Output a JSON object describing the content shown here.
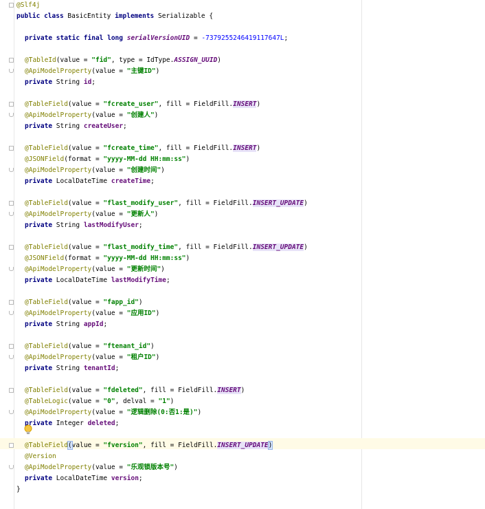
{
  "editor": {
    "class_annotation": "@Slf4j",
    "kw_public": "public",
    "kw_class": "class",
    "class_name": "BasicEntity",
    "kw_implements": "implements",
    "interface_name": "Serializable",
    "open_brace": "{",
    "close_brace": "}",
    "serial": {
      "modifiers": "private static final long",
      "name": "serialVersionUID",
      "assign": " = ",
      "value": "-7379255246419117647L",
      "semi": ";"
    },
    "fields": [
      {
        "annotations": [
          {
            "name": "@TableId",
            "args_prefix": "(value = ",
            "str": "\"fid\"",
            "args_mid": ", type = IdType.",
            "const": "ASSIGN_UUID",
            "args_suffix": ")"
          },
          {
            "name": "@ApiModelProperty",
            "args_prefix": "(value = ",
            "str": "\"主键ID\"",
            "args_suffix": ")"
          }
        ],
        "decl": {
          "modifier": "private",
          "type": "String",
          "name": "id",
          "semi": ";"
        }
      },
      {
        "annotations": [
          {
            "name": "@TableField",
            "args_prefix": "(value = ",
            "str": "\"fcreate_user\"",
            "args_mid": ", fill = FieldFill.",
            "const": "INSERT",
            "args_suffix": ")"
          },
          {
            "name": "@ApiModelProperty",
            "args_prefix": "(value = ",
            "str": "\"创建人\"",
            "args_suffix": ")"
          }
        ],
        "decl": {
          "modifier": "private",
          "type": "String",
          "name": "createUser",
          "semi": ";"
        }
      },
      {
        "annotations": [
          {
            "name": "@TableField",
            "args_prefix": "(value = ",
            "str": "\"fcreate_time\"",
            "args_mid": ", fill = FieldFill.",
            "const": "INSERT",
            "args_suffix": ")"
          },
          {
            "name": "@JSONField",
            "args_prefix": "(format = ",
            "str": "\"yyyy-MM-dd HH:mm:ss\"",
            "args_suffix": ")"
          },
          {
            "name": "@ApiModelProperty",
            "args_prefix": "(value = ",
            "str": "\"创建时间\"",
            "args_suffix": ")"
          }
        ],
        "decl": {
          "modifier": "private",
          "type": "LocalDateTime",
          "name": "createTime",
          "semi": ";"
        }
      },
      {
        "annotations": [
          {
            "name": "@TableField",
            "args_prefix": "(value = ",
            "str": "\"flast_modify_user\"",
            "args_mid": ", fill = FieldFill.",
            "const": "INSERT_UPDATE",
            "args_suffix": ")"
          },
          {
            "name": "@ApiModelProperty",
            "args_prefix": "(value = ",
            "str": "\"更新人\"",
            "args_suffix": ")"
          }
        ],
        "decl": {
          "modifier": "private",
          "type": "String",
          "name": "lastModifyUser",
          "semi": ";"
        }
      },
      {
        "annotations": [
          {
            "name": "@TableField",
            "args_prefix": "(value = ",
            "str": "\"flast_modify_time\"",
            "args_mid": ", fill = FieldFill.",
            "const": "INSERT_UPDATE",
            "args_suffix": ")"
          },
          {
            "name": "@JSONField",
            "args_prefix": "(format = ",
            "str": "\"yyyy-MM-dd HH:mm:ss\"",
            "args_suffix": ")"
          },
          {
            "name": "@ApiModelProperty",
            "args_prefix": "(value = ",
            "str": "\"更新时间\"",
            "args_suffix": ")"
          }
        ],
        "decl": {
          "modifier": "private",
          "type": "LocalDateTime",
          "name": "lastModifyTime",
          "semi": ";"
        }
      },
      {
        "annotations": [
          {
            "name": "@TableField",
            "args_prefix": "(value = ",
            "str": "\"fapp_id\"",
            "args_suffix": ")"
          },
          {
            "name": "@ApiModelProperty",
            "args_prefix": "(value = ",
            "str": "\"应用ID\"",
            "args_suffix": ")"
          }
        ],
        "decl": {
          "modifier": "private",
          "type": "String",
          "name": "appId",
          "semi": ";"
        }
      },
      {
        "annotations": [
          {
            "name": "@TableField",
            "args_prefix": "(value = ",
            "str": "\"ftenant_id\"",
            "args_suffix": ")"
          },
          {
            "name": "@ApiModelProperty",
            "args_prefix": "(value = ",
            "str": "\"租户ID\"",
            "args_suffix": ")"
          }
        ],
        "decl": {
          "modifier": "private",
          "type": "String",
          "name": "tenantId",
          "semi": ";"
        }
      },
      {
        "annotations": [
          {
            "name": "@TableField",
            "args_prefix": "(value = ",
            "str": "\"fdeleted\"",
            "args_mid": ", fill = FieldFill.",
            "const": "INSERT",
            "args_suffix": ")"
          },
          {
            "name": "@TableLogic",
            "args_prefix": "(value = ",
            "str": "\"0\"",
            "args_mid_plain": ", delval = ",
            "str2": "\"1\"",
            "args_suffix": ")"
          },
          {
            "name": "@ApiModelProperty",
            "args_prefix": "(value = ",
            "str": "\"逻辑删除(0:否1:是)\"",
            "args_suffix": ")"
          }
        ],
        "decl": {
          "modifier": "private",
          "type": "Integer",
          "name": "deleted",
          "semi": ";"
        }
      },
      {
        "annotations": [
          {
            "name": "@TableField",
            "args_prefix": "(value = ",
            "str": "\"fversion\"",
            "args_mid": ", fill = FieldFill.",
            "const": "INSERT_UPDATE",
            "args_suffix": ")"
          },
          {
            "name": "@Version"
          },
          {
            "name": "@ApiModelProperty",
            "args_prefix": "(value = ",
            "str": "\"乐观锁版本号\"",
            "args_suffix": ")"
          }
        ],
        "decl": {
          "modifier": "private",
          "type": "LocalDateTime",
          "name": "version",
          "semi": ";"
        }
      }
    ],
    "colors": {
      "keyword": "#000080",
      "annotation": "#808000",
      "string": "#008000",
      "number": "#0000ff",
      "field": "#660e7a",
      "caret_row": "#fffbe6"
    },
    "icons": [
      "fold-icon",
      "lightbulb-icon"
    ]
  }
}
